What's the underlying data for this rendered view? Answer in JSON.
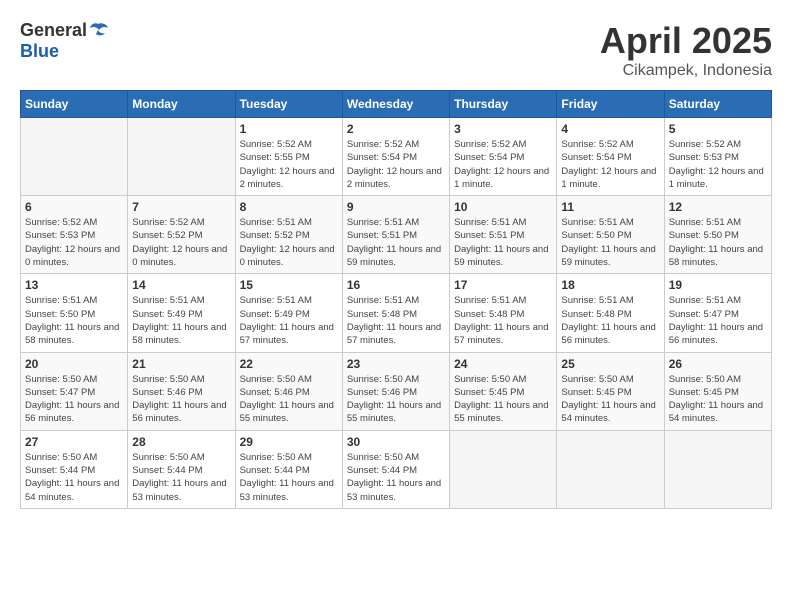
{
  "logo": {
    "general": "General",
    "blue": "Blue"
  },
  "header": {
    "month": "April 2025",
    "location": "Cikampek, Indonesia"
  },
  "weekdays": [
    "Sunday",
    "Monday",
    "Tuesday",
    "Wednesday",
    "Thursday",
    "Friday",
    "Saturday"
  ],
  "weeks": [
    [
      {
        "day": "",
        "info": ""
      },
      {
        "day": "",
        "info": ""
      },
      {
        "day": "1",
        "info": "Sunrise: 5:52 AM\nSunset: 5:55 PM\nDaylight: 12 hours and 2 minutes."
      },
      {
        "day": "2",
        "info": "Sunrise: 5:52 AM\nSunset: 5:54 PM\nDaylight: 12 hours and 2 minutes."
      },
      {
        "day": "3",
        "info": "Sunrise: 5:52 AM\nSunset: 5:54 PM\nDaylight: 12 hours and 1 minute."
      },
      {
        "day": "4",
        "info": "Sunrise: 5:52 AM\nSunset: 5:54 PM\nDaylight: 12 hours and 1 minute."
      },
      {
        "day": "5",
        "info": "Sunrise: 5:52 AM\nSunset: 5:53 PM\nDaylight: 12 hours and 1 minute."
      }
    ],
    [
      {
        "day": "6",
        "info": "Sunrise: 5:52 AM\nSunset: 5:53 PM\nDaylight: 12 hours and 0 minutes."
      },
      {
        "day": "7",
        "info": "Sunrise: 5:52 AM\nSunset: 5:52 PM\nDaylight: 12 hours and 0 minutes."
      },
      {
        "day": "8",
        "info": "Sunrise: 5:51 AM\nSunset: 5:52 PM\nDaylight: 12 hours and 0 minutes."
      },
      {
        "day": "9",
        "info": "Sunrise: 5:51 AM\nSunset: 5:51 PM\nDaylight: 11 hours and 59 minutes."
      },
      {
        "day": "10",
        "info": "Sunrise: 5:51 AM\nSunset: 5:51 PM\nDaylight: 11 hours and 59 minutes."
      },
      {
        "day": "11",
        "info": "Sunrise: 5:51 AM\nSunset: 5:50 PM\nDaylight: 11 hours and 59 minutes."
      },
      {
        "day": "12",
        "info": "Sunrise: 5:51 AM\nSunset: 5:50 PM\nDaylight: 11 hours and 58 minutes."
      }
    ],
    [
      {
        "day": "13",
        "info": "Sunrise: 5:51 AM\nSunset: 5:50 PM\nDaylight: 11 hours and 58 minutes."
      },
      {
        "day": "14",
        "info": "Sunrise: 5:51 AM\nSunset: 5:49 PM\nDaylight: 11 hours and 58 minutes."
      },
      {
        "day": "15",
        "info": "Sunrise: 5:51 AM\nSunset: 5:49 PM\nDaylight: 11 hours and 57 minutes."
      },
      {
        "day": "16",
        "info": "Sunrise: 5:51 AM\nSunset: 5:48 PM\nDaylight: 11 hours and 57 minutes."
      },
      {
        "day": "17",
        "info": "Sunrise: 5:51 AM\nSunset: 5:48 PM\nDaylight: 11 hours and 57 minutes."
      },
      {
        "day": "18",
        "info": "Sunrise: 5:51 AM\nSunset: 5:48 PM\nDaylight: 11 hours and 56 minutes."
      },
      {
        "day": "19",
        "info": "Sunrise: 5:51 AM\nSunset: 5:47 PM\nDaylight: 11 hours and 56 minutes."
      }
    ],
    [
      {
        "day": "20",
        "info": "Sunrise: 5:50 AM\nSunset: 5:47 PM\nDaylight: 11 hours and 56 minutes."
      },
      {
        "day": "21",
        "info": "Sunrise: 5:50 AM\nSunset: 5:46 PM\nDaylight: 11 hours and 56 minutes."
      },
      {
        "day": "22",
        "info": "Sunrise: 5:50 AM\nSunset: 5:46 PM\nDaylight: 11 hours and 55 minutes."
      },
      {
        "day": "23",
        "info": "Sunrise: 5:50 AM\nSunset: 5:46 PM\nDaylight: 11 hours and 55 minutes."
      },
      {
        "day": "24",
        "info": "Sunrise: 5:50 AM\nSunset: 5:45 PM\nDaylight: 11 hours and 55 minutes."
      },
      {
        "day": "25",
        "info": "Sunrise: 5:50 AM\nSunset: 5:45 PM\nDaylight: 11 hours and 54 minutes."
      },
      {
        "day": "26",
        "info": "Sunrise: 5:50 AM\nSunset: 5:45 PM\nDaylight: 11 hours and 54 minutes."
      }
    ],
    [
      {
        "day": "27",
        "info": "Sunrise: 5:50 AM\nSunset: 5:44 PM\nDaylight: 11 hours and 54 minutes."
      },
      {
        "day": "28",
        "info": "Sunrise: 5:50 AM\nSunset: 5:44 PM\nDaylight: 11 hours and 53 minutes."
      },
      {
        "day": "29",
        "info": "Sunrise: 5:50 AM\nSunset: 5:44 PM\nDaylight: 11 hours and 53 minutes."
      },
      {
        "day": "30",
        "info": "Sunrise: 5:50 AM\nSunset: 5:44 PM\nDaylight: 11 hours and 53 minutes."
      },
      {
        "day": "",
        "info": ""
      },
      {
        "day": "",
        "info": ""
      },
      {
        "day": "",
        "info": ""
      }
    ]
  ]
}
